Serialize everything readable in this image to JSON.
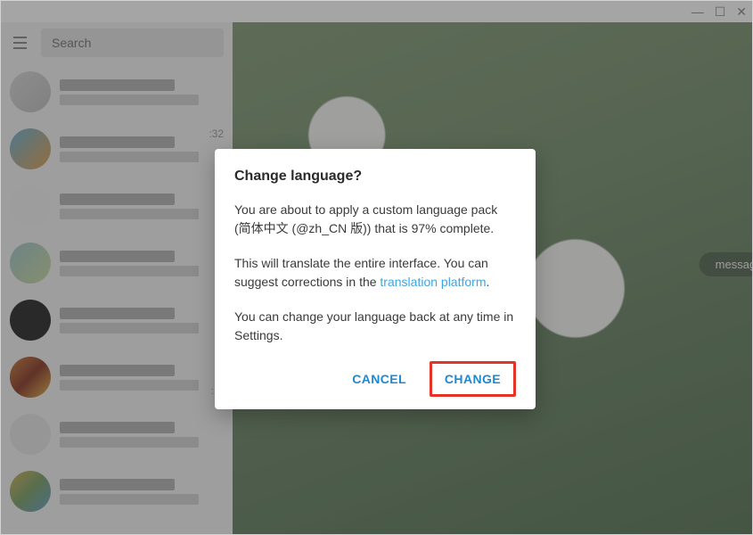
{
  "window": {
    "minimize_glyph": "—",
    "maximize_glyph": "☐",
    "close_glyph": "✕"
  },
  "sidebar": {
    "search_placeholder": "Search",
    "items": [
      {
        "time": "",
        "badge": ""
      },
      {
        "time": ":32",
        "badge": ""
      },
      {
        "time": "",
        "badge": ""
      },
      {
        "time": "",
        "badge": ""
      },
      {
        "time": "",
        "badge": ""
      },
      {
        "time": "",
        "badge": ":..."
      },
      {
        "time": "",
        "badge": ""
      },
      {
        "time": "",
        "badge": ""
      }
    ]
  },
  "main": {
    "pill_text": "messaging"
  },
  "dialog": {
    "title": "Change language?",
    "p1_a": "You are about to apply a custom language pack (",
    "p1_b": "简体中文 (@zh_CN 版)",
    "p1_c": ") that is 97% complete.",
    "p2_a": "This will translate the entire interface. You can suggest corrections in the ",
    "p2_link": "translation platform",
    "p2_b": ".",
    "p3": "You can change your language back at any time in Settings.",
    "cancel_label": "CANCEL",
    "change_label": "CHANGE"
  }
}
